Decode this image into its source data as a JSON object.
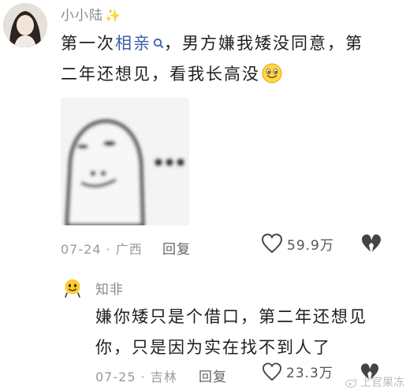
{
  "comment": {
    "username": "小小陆",
    "text_before_link": "第一次",
    "link_text": "相亲",
    "text_line1_after": "，男方嫌我矮没同意，第",
    "text_line2": "二年还想见，看我长高没",
    "date": "07-24",
    "location": "广西",
    "reply_label": "回复",
    "like_count": "59.9万"
  },
  "reply": {
    "username": "知非",
    "text_line1": "嫌你矮只是个借口，第二年还想见",
    "text_line2": "你，只是因为实在找不到人了",
    "date": "07-25",
    "location": "吉林",
    "reply_label": "回复",
    "like_count": "23.3万"
  },
  "watermark": "上官果冻",
  "icons": {
    "sparkle": "sparkle-icon",
    "search": "search-icon",
    "like": "heart-outline-icon",
    "dislike": "broken-heart-icon",
    "emoji": "grinning-face-icon"
  },
  "colors": {
    "link": "#3f5ea8",
    "meta": "#9a9a9a",
    "sparkle": "#f5b838"
  }
}
